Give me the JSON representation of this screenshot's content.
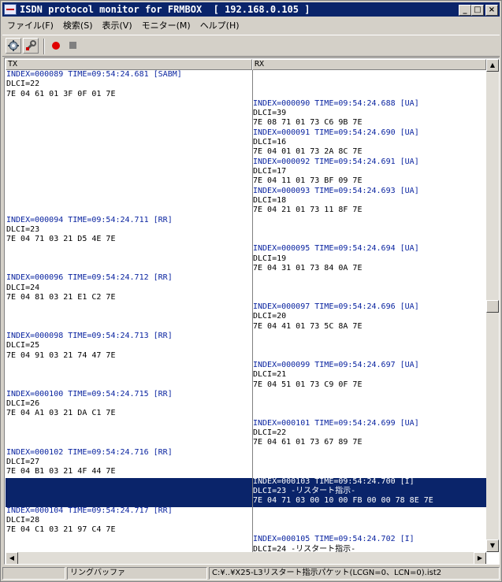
{
  "window": {
    "title": "ISDN protocol monitor for FRMBOX  [ 192.168.0.105 ]",
    "controls": {
      "minimize": "_",
      "maximize": "□",
      "close": "×"
    }
  },
  "menu": [
    {
      "label": "ファイル(F)"
    },
    {
      "label": "検索(S)"
    },
    {
      "label": "表示(V)"
    },
    {
      "label": "モニター(M)"
    },
    {
      "label": "ヘルプ(H)"
    }
  ],
  "toolbar": {
    "icons": [
      "settings-icon",
      "wrench-icon",
      "record-icon",
      "stop-icon"
    ],
    "record_color": "#e00000"
  },
  "columns": {
    "tx": "TX",
    "rx": "RX"
  },
  "log": {
    "selected_index": "000103",
    "selected_color": "#0a246a",
    "header_color": "#0a24a0",
    "entries": [
      {
        "side": "tx",
        "row": 0,
        "header": "INDEX=000089 TIME=09:54:24.681 [SABM]",
        "line1": "DLCI=22",
        "line2": "7E 04 61 01 3F 0F 01 7E"
      },
      {
        "side": "rx",
        "row": 3,
        "header": "INDEX=000090 TIME=09:54:24.688 [UA]",
        "line1": "DLCI=39",
        "line2": "7E 08 71 01 73 C6 9B 7E"
      },
      {
        "side": "rx",
        "row": 6,
        "header": "INDEX=000091 TIME=09:54:24.690 [UA]",
        "line1": "DLCI=16",
        "line2": "7E 04 01 01 73 2A 8C 7E"
      },
      {
        "side": "rx",
        "row": 9,
        "header": "INDEX=000092 TIME=09:54:24.691 [UA]",
        "line1": "DLCI=17",
        "line2": "7E 04 11 01 73 BF 09 7E"
      },
      {
        "side": "rx",
        "row": 12,
        "header": "INDEX=000093 TIME=09:54:24.693 [UA]",
        "line1": "DLCI=18",
        "line2": "7E 04 21 01 73 11 8F 7E"
      },
      {
        "side": "tx",
        "row": 15,
        "header": "INDEX=000094 TIME=09:54:24.711 [RR]",
        "line1": "DLCI=23",
        "line2": "7E 04 71 03 21 D5 4E 7E"
      },
      {
        "side": "rx",
        "row": 18,
        "header": "INDEX=000095 TIME=09:54:24.694 [UA]",
        "line1": "DLCI=19",
        "line2": "7E 04 31 01 73 84 0A 7E"
      },
      {
        "side": "tx",
        "row": 21,
        "header": "INDEX=000096 TIME=09:54:24.712 [RR]",
        "line1": "DLCI=24",
        "line2": "7E 04 81 03 21 E1 C2 7E"
      },
      {
        "side": "rx",
        "row": 24,
        "header": "INDEX=000097 TIME=09:54:24.696 [UA]",
        "line1": "DLCI=20",
        "line2": "7E 04 41 01 73 5C 8A 7E"
      },
      {
        "side": "tx",
        "row": 27,
        "header": "INDEX=000098 TIME=09:54:24.713 [RR]",
        "line1": "DLCI=25",
        "line2": "7E 04 91 03 21 74 47 7E"
      },
      {
        "side": "rx",
        "row": 30,
        "header": "INDEX=000099 TIME=09:54:24.697 [UA]",
        "line1": "DLCI=21",
        "line2": "7E 04 51 01 73 C9 0F 7E"
      },
      {
        "side": "tx",
        "row": 33,
        "header": "INDEX=000100 TIME=09:54:24.715 [RR]",
        "line1": "DLCI=26",
        "line2": "7E 04 A1 03 21 DA C1 7E"
      },
      {
        "side": "rx",
        "row": 36,
        "header": "INDEX=000101 TIME=09:54:24.699 [UA]",
        "line1": "DLCI=22",
        "line2": "7E 04 61 01 73 67 89 7E"
      },
      {
        "side": "tx",
        "row": 39,
        "header": "INDEX=000102 TIME=09:54:24.716 [RR]",
        "line1": "DLCI=27",
        "line2": "7E 04 B1 03 21 4F 44 7E"
      },
      {
        "side": "rx",
        "row": 42,
        "header": "INDEX=000103 TIME=09:54:24.700 [I]",
        "line1": "DLCI=23 -リスタート指示-",
        "line2": "7E 04 71 03 00 10 00 FB 00 00 78 8E 7E",
        "selected": true
      },
      {
        "side": "tx",
        "row": 45,
        "header": "INDEX=000104 TIME=09:54:24.717 [RR]",
        "line1": "DLCI=28",
        "line2": "7E 04 C1 03 21 97 C4 7E"
      },
      {
        "side": "rx",
        "row": 48,
        "header": "INDEX=000105 TIME=09:54:24.702 [I]",
        "line1": "DLCI=24 -リスタート指示-",
        "line2": ""
      }
    ]
  },
  "scroll": {
    "vertical_position": 0.48
  },
  "status": {
    "panel1": "",
    "panel2": "リングバッファ",
    "panel3": "C:¥..¥X25-L3リスタート指示パケット(LCGN=0、LCN=0).ist2"
  }
}
